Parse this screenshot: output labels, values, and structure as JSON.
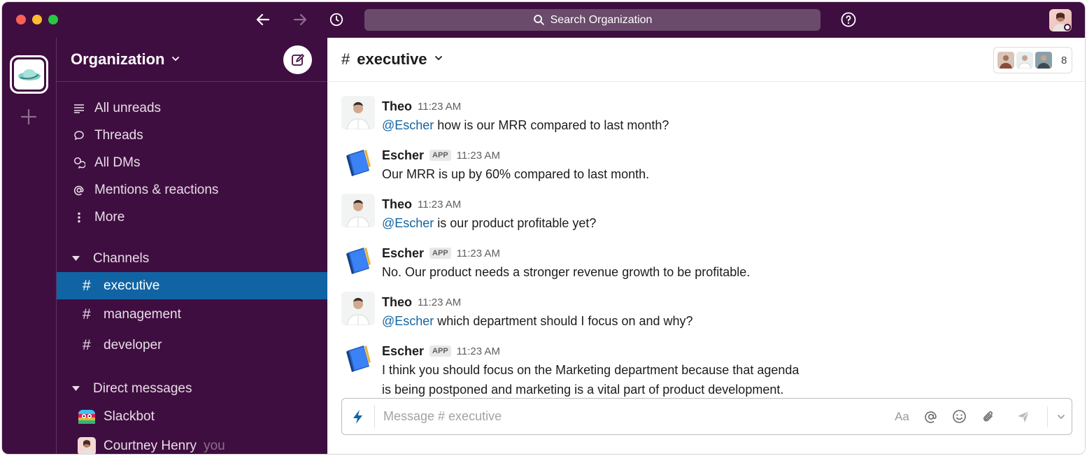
{
  "titlebar": {
    "search_label": "Search Organization"
  },
  "sidebar": {
    "org_name": "Organization",
    "nav": [
      {
        "label": "All unreads",
        "icon": "list-icon"
      },
      {
        "label": "Threads",
        "icon": "thread-icon"
      },
      {
        "label": "All DMs",
        "icon": "dms-icon"
      },
      {
        "label": "Mentions & reactions",
        "icon": "at-icon"
      },
      {
        "label": "More",
        "icon": "more-vertical-icon"
      }
    ],
    "channels_label": "Channels",
    "channels": [
      "executive",
      "management",
      "developer"
    ],
    "active_channel": "executive",
    "dms_label": "Direct messages",
    "dms": [
      {
        "name": "Slackbot",
        "suffix": ""
      },
      {
        "name": "Courtney Henry",
        "suffix": "you"
      }
    ]
  },
  "channel": {
    "name": "executive",
    "member_count": "8"
  },
  "messages": [
    {
      "author": "Theo",
      "app": false,
      "time": "11:23 AM",
      "mention": "@Escher",
      "text": " how is our MRR compared to last month?"
    },
    {
      "author": "Escher",
      "app": true,
      "app_label": "APP",
      "time": "11:23 AM",
      "mention": "",
      "text": "Our MRR is up by 60% compared to last month."
    },
    {
      "author": "Theo",
      "app": false,
      "time": "11:23 AM",
      "mention": "@Escher",
      "text": " is our product profitable yet?"
    },
    {
      "author": "Escher",
      "app": true,
      "app_label": "APP",
      "time": "11:23 AM",
      "mention": "",
      "text": "No. Our product needs a stronger revenue growth to be profitable."
    },
    {
      "author": "Theo",
      "app": false,
      "time": "11:23 AM",
      "mention": "@Escher",
      "text": " which department should I focus on and why?"
    },
    {
      "author": "Escher",
      "app": true,
      "app_label": "APP",
      "time": "11:23 AM",
      "mention": "",
      "text_lines": [
        "I think you should focus on the Marketing department because that agenda",
        "is being postponed and marketing is a vital part of product development."
      ]
    }
  ],
  "composer": {
    "placeholder": "Message # executive",
    "format_label": "Aa"
  },
  "colors": {
    "aubergine": "#3f0e40",
    "active_channel": "#1164a3",
    "mention": "#1264a3"
  }
}
